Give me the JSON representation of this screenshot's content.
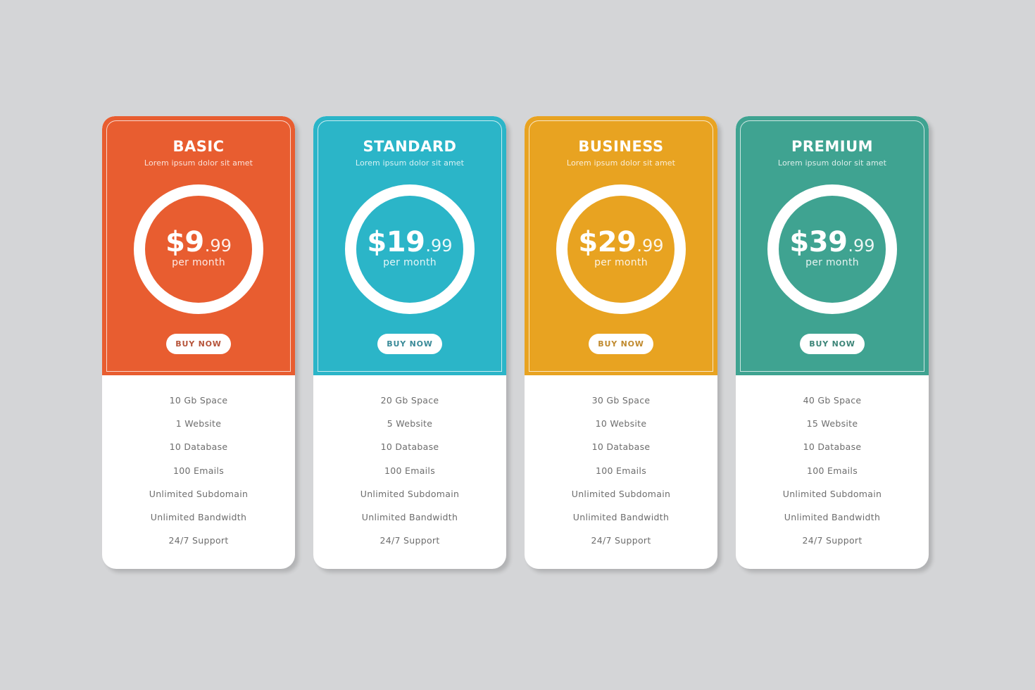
{
  "background_color": "#D4D5D7",
  "plans": [
    {
      "id": "basic",
      "name": "BASIC",
      "subtitle": "Lorem ipsum dolor sit amet",
      "price_main": "$9",
      "price_cents": ".99",
      "period": "per month",
      "button_label": "BUY NOW",
      "color": "#E85D30",
      "button_text_color": "#B6543A",
      "features": [
        "10 Gb Space",
        "1 Website",
        "10 Database",
        "100 Emails",
        "Unlimited Subdomain",
        "Unlimited Bandwidth",
        "24/7 Support"
      ]
    },
    {
      "id": "standard",
      "name": "STANDARD",
      "subtitle": "Lorem ipsum dolor sit amet",
      "price_main": "$19",
      "price_cents": ".99",
      "period": "per month",
      "button_label": "BUY NOW",
      "color": "#2BB5C8",
      "button_text_color": "#3A8A98",
      "features": [
        "20 Gb Space",
        "5 Website",
        "10 Database",
        "100 Emails",
        "Unlimited Subdomain",
        "Unlimited Bandwidth",
        "24/7 Support"
      ]
    },
    {
      "id": "business",
      "name": "BUSINESS",
      "subtitle": "Lorem ipsum dolor sit amet",
      "price_main": "$29",
      "price_cents": ".99",
      "period": "per month",
      "button_label": "BUY NOW",
      "color": "#E8A321",
      "button_text_color": "#C08A2E",
      "features": [
        "30 Gb Space",
        "10 Website",
        "10 Database",
        "100 Emails",
        "Unlimited Subdomain",
        "Unlimited Bandwidth",
        "24/7 Support"
      ]
    },
    {
      "id": "premium",
      "name": "PREMIUM",
      "subtitle": "Lorem ipsum dolor sit amet",
      "price_main": "$39",
      "price_cents": ".99",
      "period": "per month",
      "button_label": "BUY NOW",
      "color": "#3FA391",
      "button_text_color": "#3D8578",
      "features": [
        "40 Gb Space",
        "15 Website",
        "10 Database",
        "100 Emails",
        "Unlimited Subdomain",
        "Unlimited Bandwidth",
        "24/7 Support"
      ]
    }
  ]
}
